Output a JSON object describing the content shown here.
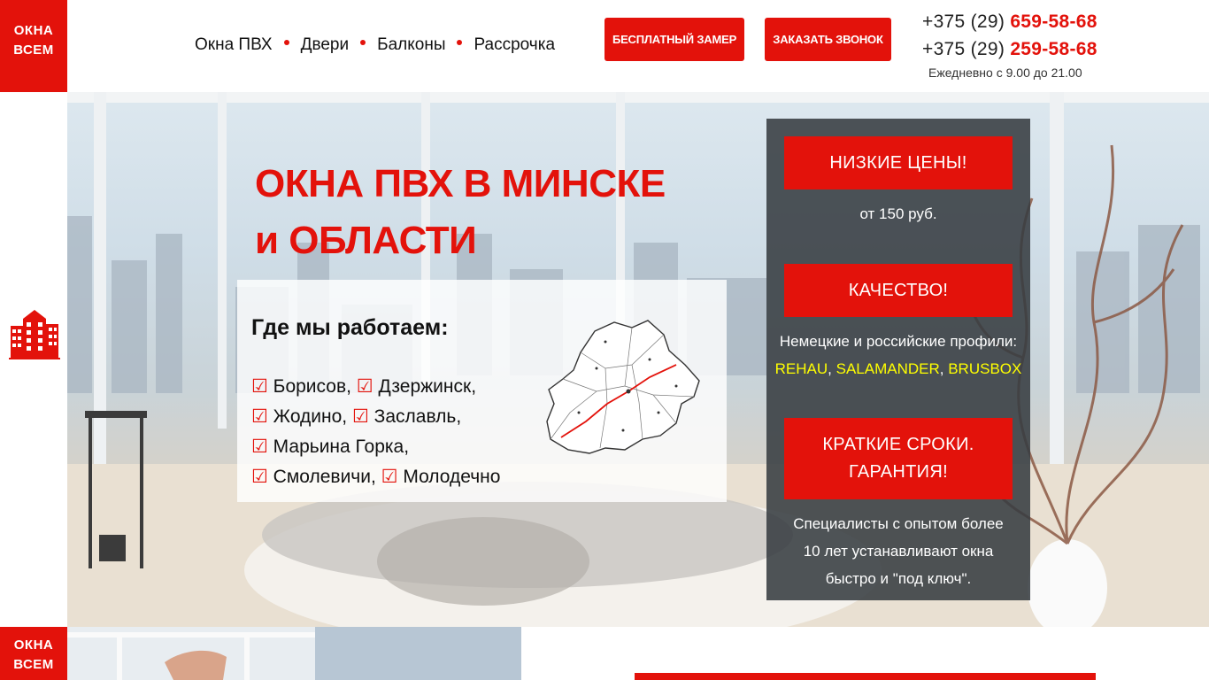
{
  "logo": {
    "line1": "ОКНА",
    "line2": "ВСЕМ"
  },
  "nav": {
    "items": [
      "Окна ПВХ",
      "Двери",
      "Балконы",
      "Рассрочка"
    ]
  },
  "header": {
    "free_measure_label": "БЕСПЛАТНЫЙ ЗАМЕР",
    "order_call_label": "ЗАКАЗАТЬ ЗВОНОК",
    "phone1_prefix": "+375 (29)",
    "phone1_number": "659-58-68",
    "phone2_prefix": "+375 (29)",
    "phone2_number": "259-58-68",
    "hours": "Ежедневно с 9.00 до 21.00"
  },
  "hero": {
    "title_line1": "ОКНА ПВХ В МИНСКЕ",
    "title_line2": "и ОБЛАСТИ",
    "where_title": "Где мы работаем:",
    "check_symbol": "☑",
    "cities": {
      "borisov": "Борисов,",
      "dzerzhinsk": "Дзержинск,",
      "zhodino": "Жодино,",
      "zaslavl": "Заславль,",
      "marina_gorka": "Марьина Горка,",
      "smolevichi": "Смолевичи,",
      "molodechno": "Молодечно"
    }
  },
  "features": {
    "price_label": "НИЗКИЕ ЦЕНЫ!",
    "price_text": "от 150 руб.",
    "quality_label": "КАЧЕСТВО!",
    "quality_text": "Немецкие и российские профили:",
    "brand1": "REHAU",
    "brand2": "SALAMANDER",
    "brand3": "BRUSBOX",
    "comma": ",",
    "terms_line1": "КРАТКИЕ СРОКИ.",
    "terms_line2": "ГАРАНТИЯ!",
    "terms_text_line1": "Специалисты с опытом более",
    "terms_text_line2": "10 лет устанавливают окна",
    "terms_text_line3": "быстро и \"под ключ\"."
  },
  "colors": {
    "accent": "#e3120b",
    "panel": "#373c41",
    "highlight": "#ffff00"
  },
  "icons": {
    "side": "building-icon",
    "map": "belarus-map-icon"
  }
}
